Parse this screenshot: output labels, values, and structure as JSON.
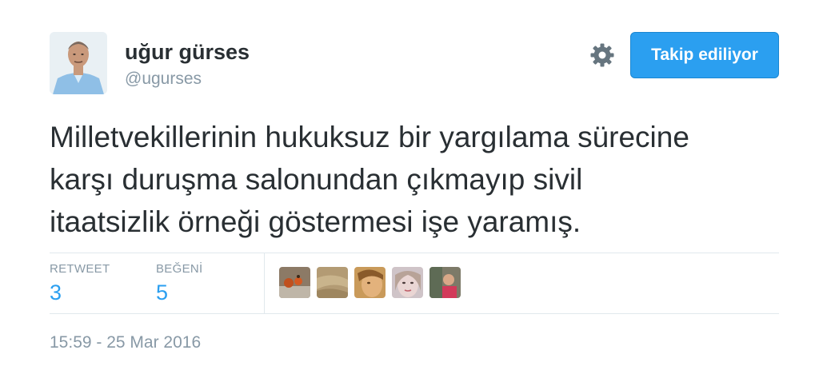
{
  "author": {
    "display_name": "uğur gürses",
    "screen_name": "@ugurses"
  },
  "header": {
    "follow_label": "Takip ediliyor"
  },
  "tweet": {
    "lines": [
      "Milletvekillerinin hukuksuz bir yargılama sürecine",
      "karşı duruşma salonundan çıkmayıp sivil",
      "itaatsizlik örneği göstermesi işe yaramış."
    ]
  },
  "stats": {
    "retweet_label": "RETWEET",
    "retweet_count": "3",
    "like_label": "BEĞENİ",
    "like_count": "5"
  },
  "likers": [
    "liker-avatar-1",
    "liker-avatar-2",
    "liker-avatar-3",
    "liker-avatar-4",
    "liker-avatar-5"
  ],
  "timestamp": "15:59 - 25 Mar 2016",
  "colors": {
    "accent": "#2b9ff0",
    "text": "#292f33",
    "muted": "#8899a6",
    "border": "#e1e8ed"
  },
  "icons": {
    "settings": "gear-icon"
  }
}
